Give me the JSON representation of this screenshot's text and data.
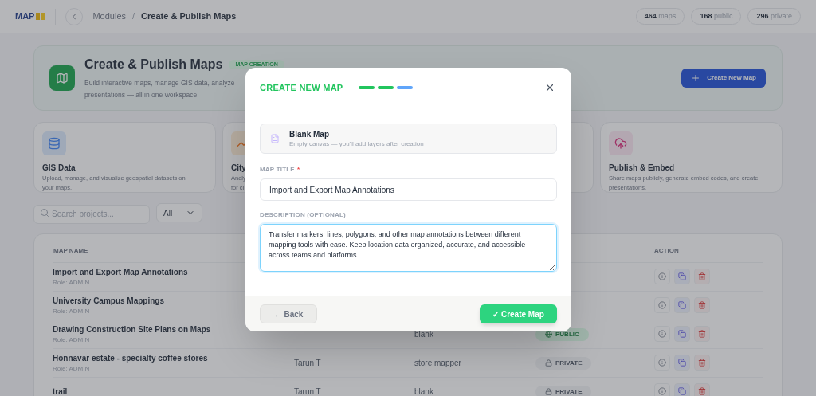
{
  "header": {
    "logo": "MAP",
    "breadcrumb": [
      "Modules",
      "Create & Publish Maps"
    ],
    "breadcrumb_separator": "/",
    "stats": [
      {
        "count": "464",
        "label": "maps"
      },
      {
        "count": "168",
        "label": "public"
      },
      {
        "count": "296",
        "label": "private"
      }
    ]
  },
  "hero": {
    "title": "Create & Publish Maps",
    "badge": "MAP CREATION",
    "subtitle_lines": [
      "Build interactive maps, manage GIS data, analyze",
      "presentations — all in one workspace."
    ],
    "button": "Create New Map"
  },
  "features": [
    {
      "kind": "data",
      "title": "GIS Data",
      "description_lines": [
        "Upload, manage, and visualize geospatial datasets on",
        "your maps."
      ]
    },
    {
      "kind": "chart",
      "title": "City",
      "description_lines": [
        "Analy",
        "for cl"
      ]
    },
    {
      "kind": "none"
    },
    {
      "kind": "publish",
      "title": "Publish & Embed",
      "description_lines": [
        "Share maps publicly, generate embed codes, and create",
        "presentations."
      ]
    }
  ],
  "filters": {
    "search_placeholder": "Search projects...",
    "select": "All"
  },
  "table": {
    "columns": {
      "name": "MAP NAME",
      "action": "ACTION"
    },
    "rows": [
      {
        "name": "Import and Export Map Annotations",
        "role": "Role: ADMIN"
      },
      {
        "name": "University Campus Mappings",
        "role": "Role: ADMIN"
      },
      {
        "name": "Drawing Construction Site Plans on Maps",
        "role": "Role: ADMIN",
        "type": "blank",
        "status": {
          "kind": "public",
          "label": "PUBLIC"
        }
      },
      {
        "name": "Honnavar estate - specialty coffee stores",
        "role": "Role: ADMIN",
        "owner": "Tarun T",
        "type": "store mapper",
        "status": {
          "kind": "private",
          "label": "PRIVATE"
        }
      },
      {
        "name": "trail",
        "owner": "Tarun T",
        "type": "blank",
        "status": {
          "kind": "private",
          "label": "PRIVATE"
        }
      }
    ]
  },
  "modal": {
    "title": "CREATE NEW MAP",
    "steps": [
      {
        "done": true
      },
      {
        "done": true
      },
      {
        "done": false
      }
    ],
    "template": {
      "title": "Blank Map",
      "subtitle": "Empty canvas — you'll add layers after creation"
    },
    "title_field": {
      "label": "MAP TITLE",
      "required_mark": "*",
      "value": "Import and Export Map Annotations"
    },
    "description_field": {
      "label": "DESCRIPTION (OPTIONAL)",
      "value": "Transfer markers, lines, polygons, and other map annotations between different mapping tools with ease. Keep location data organized, accurate, and accessible across teams and platforms.",
      "focused": true
    },
    "back": "← Back",
    "submit": "✓ Create Map"
  }
}
